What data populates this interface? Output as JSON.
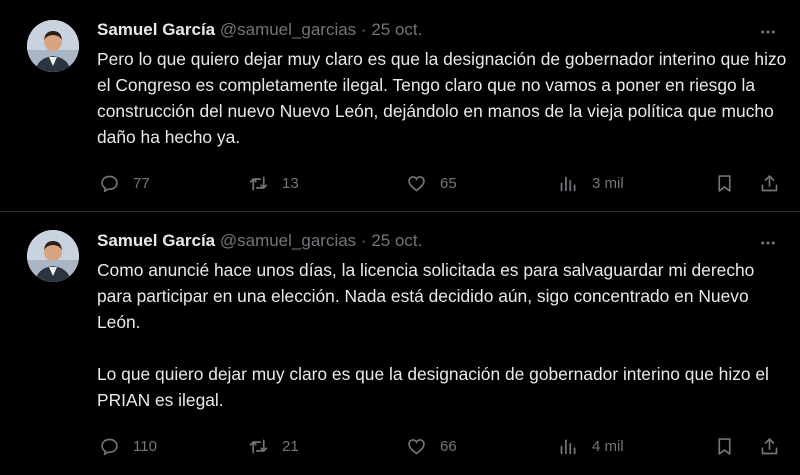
{
  "tweets": [
    {
      "author": {
        "name": "Samuel García",
        "handle": "@samuel_garcias",
        "separator": "·",
        "date": "25 oct."
      },
      "text": "Pero lo que quiero dejar muy claro es que la designación de gobernador interino que hizo el Congreso es completamente ilegal. Tengo claro que no vamos a poner en riesgo la construcción del nuevo Nuevo León, dejándolo en manos de la vieja política que mucho daño ha hecho ya.",
      "stats": {
        "replies": "77",
        "retweets": "13",
        "likes": "65",
        "views": "3 mil"
      }
    },
    {
      "author": {
        "name": "Samuel García",
        "handle": "@samuel_garcias",
        "separator": "·",
        "date": "25 oct."
      },
      "text": "Como anuncié hace unos días, la licencia solicitada es para salvaguardar mi derecho para participar en una elección. Nada está decidido aún, sigo concentrado en Nuevo León.",
      "text2": "Lo que quiero dejar muy claro es que la designación de gobernador interino que hizo el PRIAN es ilegal.",
      "stats": {
        "replies": "110",
        "retweets": "21",
        "likes": "66",
        "views": "4 mil"
      }
    }
  ],
  "icons": [
    "more-icon",
    "reply-icon",
    "retweet-icon",
    "like-icon",
    "views-icon",
    "bookmark-icon",
    "share-icon"
  ],
  "colors": {
    "background": "#000000",
    "text": "#e7e9ea",
    "muted": "#71767b",
    "divider": "#2f3336"
  }
}
